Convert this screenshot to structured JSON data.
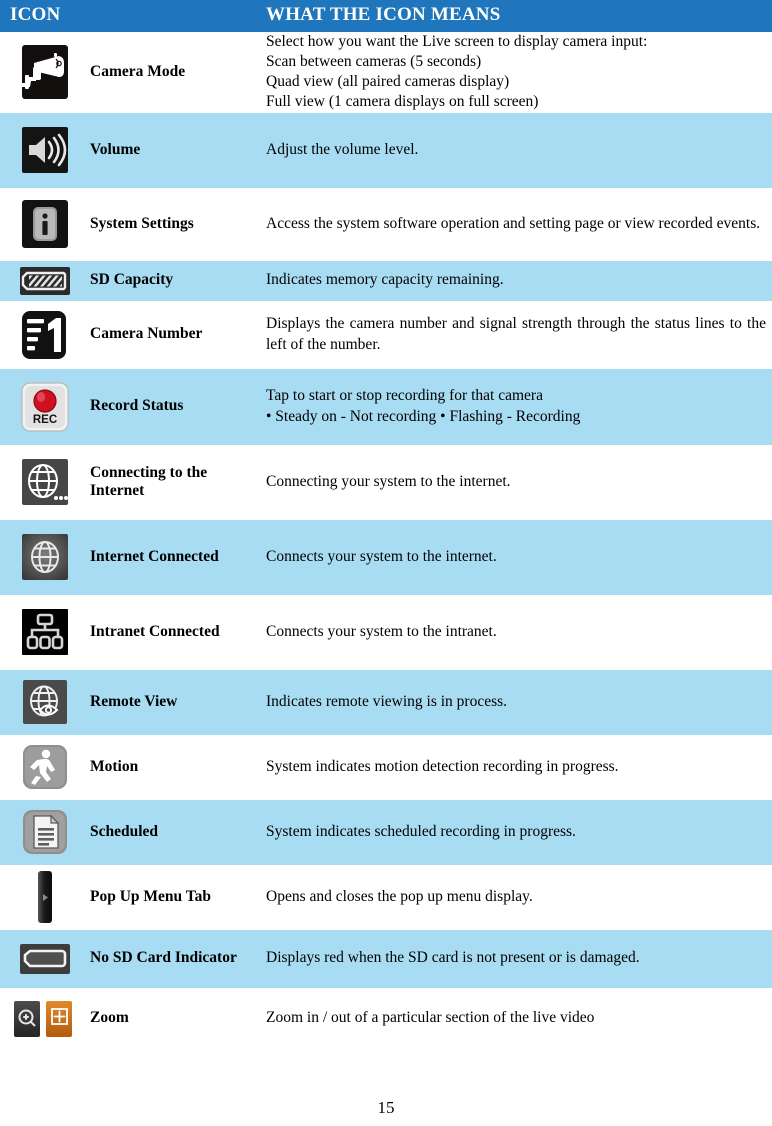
{
  "page": {
    "number": "15",
    "header_bg": "#1f76bc",
    "band_bg": "#a8dcf2",
    "plain_bg": "#ffffff"
  },
  "table": {
    "headers": {
      "icon": "ICON",
      "meaning": "WHAT THE ICON MEANS"
    },
    "rows": [
      {
        "icon_name": "camera-mode-icon",
        "label": "Camera Mode",
        "lines": [
          "Select how you want the Live screen to display camera input:",
          "Scan between cameras (5 seconds)",
          "Quad view (all paired cameras display)",
          "Full view (1 camera displays on full screen)"
        ]
      },
      {
        "icon_name": "volume-icon",
        "label": "Volume",
        "lines": [
          "Adjust the volume level."
        ]
      },
      {
        "icon_name": "system-settings-icon",
        "label": "System Settings",
        "lines": [
          "Access the system software operation and setting page or view recorded events."
        ]
      },
      {
        "icon_name": "sd-capacity-icon",
        "label": "SD Capacity",
        "lines": [
          "Indicates memory capacity remaining."
        ]
      },
      {
        "icon_name": "camera-number-icon",
        "label": "Camera Number",
        "lines": [
          "Displays the camera number and signal strength through the status lines to the left of the number."
        ]
      },
      {
        "icon_name": "record-status-icon",
        "label": "Record Status",
        "lines": [
          "Tap to start or stop recording for that camera",
          "• Steady on - Not recording • Flashing - Recording"
        ]
      },
      {
        "icon_name": "connecting-to-internet-icon",
        "label": "Connecting to the Internet",
        "lines": [
          "Connecting your system to the internet."
        ]
      },
      {
        "icon_name": "internet-connected-icon",
        "label": "Internet Connected",
        "lines": [
          "Connects your system to the internet."
        ]
      },
      {
        "icon_name": "intranet-connected-icon",
        "label": "Intranet Connected",
        "lines": [
          "Connects your system to the intranet."
        ]
      },
      {
        "icon_name": "remote-view-icon",
        "label": "Remote View",
        "lines": [
          "Indicates remote viewing is in process."
        ]
      },
      {
        "icon_name": "motion-icon",
        "label": "Motion",
        "lines": [
          "System indicates motion detection recording in progress."
        ]
      },
      {
        "icon_name": "scheduled-icon",
        "label": "Scheduled",
        "lines": [
          "System indicates scheduled recording in progress."
        ]
      },
      {
        "icon_name": "pop-up-menu-tab-icon",
        "label": "Pop Up Menu Tab",
        "lines": [
          "Opens and closes the pop up menu display."
        ]
      },
      {
        "icon_name": "no-sd-card-indicator-icon",
        "label": "No SD Card Indicator",
        "lines": [
          "Displays red when the SD card is not present or is damaged."
        ]
      },
      {
        "icon_name": "zoom-icon",
        "label": "Zoom",
        "lines": [
          "Zoom in / out of a particular section of the live video"
        ]
      }
    ]
  }
}
